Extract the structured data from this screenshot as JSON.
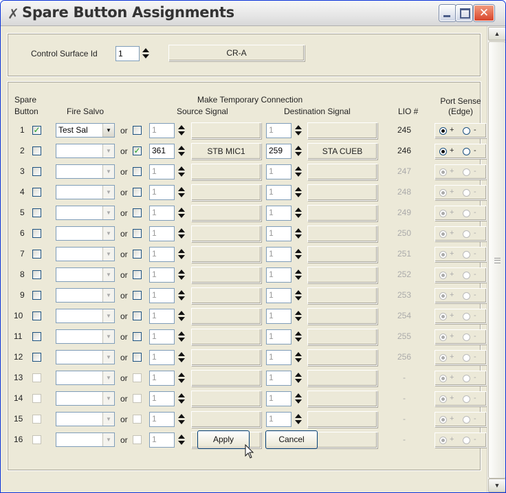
{
  "window": {
    "title": "Spare Button Assignments",
    "app_icon": "✗",
    "controls": {
      "minimize": "minimize",
      "maximize": "maximize",
      "close": "✕"
    }
  },
  "control_surface": {
    "label": "Control Surface Id",
    "id_value": "1",
    "name": "CR-A"
  },
  "headers": {
    "spare_button": [
      "Spare",
      "Button"
    ],
    "fire_salvo": "Fire Salvo",
    "make_temp": "Make Temporary Connection",
    "source": "Source Signal",
    "destination": "Destination Signal",
    "lio": "LIO #",
    "port_sense": [
      "Port Sense",
      "(Edge)"
    ],
    "or_label": "or"
  },
  "rows": [
    {
      "num": "1",
      "salvo_checked": true,
      "salvo": "Test Sal",
      "conn_checked": false,
      "src": "1",
      "src_name": "",
      "dst": "1",
      "dst_name": "",
      "lio": "245",
      "lio_enabled": true,
      "sense_enabled": true
    },
    {
      "num": "2",
      "salvo_checked": false,
      "salvo": "",
      "conn_checked": true,
      "src": "361",
      "src_name": "STB MIC1",
      "dst": "259",
      "dst_name": "STA CUEB",
      "lio": "246",
      "lio_enabled": true,
      "sense_enabled": true
    },
    {
      "num": "3",
      "salvo_checked": false,
      "salvo": "",
      "conn_checked": false,
      "src": "1",
      "src_name": "",
      "dst": "1",
      "dst_name": "",
      "lio": "247",
      "lio_enabled": false,
      "sense_enabled": false
    },
    {
      "num": "4",
      "salvo_checked": false,
      "salvo": "",
      "conn_checked": false,
      "src": "1",
      "src_name": "",
      "dst": "1",
      "dst_name": "",
      "lio": "248",
      "lio_enabled": false,
      "sense_enabled": false
    },
    {
      "num": "5",
      "salvo_checked": false,
      "salvo": "",
      "conn_checked": false,
      "src": "1",
      "src_name": "",
      "dst": "1",
      "dst_name": "",
      "lio": "249",
      "lio_enabled": false,
      "sense_enabled": false
    },
    {
      "num": "6",
      "salvo_checked": false,
      "salvo": "",
      "conn_checked": false,
      "src": "1",
      "src_name": "",
      "dst": "1",
      "dst_name": "",
      "lio": "250",
      "lio_enabled": false,
      "sense_enabled": false
    },
    {
      "num": "7",
      "salvo_checked": false,
      "salvo": "",
      "conn_checked": false,
      "src": "1",
      "src_name": "",
      "dst": "1",
      "dst_name": "",
      "lio": "251",
      "lio_enabled": false,
      "sense_enabled": false
    },
    {
      "num": "8",
      "salvo_checked": false,
      "salvo": "",
      "conn_checked": false,
      "src": "1",
      "src_name": "",
      "dst": "1",
      "dst_name": "",
      "lio": "252",
      "lio_enabled": false,
      "sense_enabled": false
    },
    {
      "num": "9",
      "salvo_checked": false,
      "salvo": "",
      "conn_checked": false,
      "src": "1",
      "src_name": "",
      "dst": "1",
      "dst_name": "",
      "lio": "253",
      "lio_enabled": false,
      "sense_enabled": false
    },
    {
      "num": "10",
      "salvo_checked": false,
      "salvo": "",
      "conn_checked": false,
      "src": "1",
      "src_name": "",
      "dst": "1",
      "dst_name": "",
      "lio": "254",
      "lio_enabled": false,
      "sense_enabled": false
    },
    {
      "num": "11",
      "salvo_checked": false,
      "salvo": "",
      "conn_checked": false,
      "src": "1",
      "src_name": "",
      "dst": "1",
      "dst_name": "",
      "lio": "255",
      "lio_enabled": false,
      "sense_enabled": false
    },
    {
      "num": "12",
      "salvo_checked": false,
      "salvo": "",
      "conn_checked": false,
      "src": "1",
      "src_name": "",
      "dst": "1",
      "dst_name": "",
      "lio": "256",
      "lio_enabled": false,
      "sense_enabled": false
    },
    {
      "num": "13",
      "salvo_checked": false,
      "salvo": "",
      "conn_checked": false,
      "src": "1",
      "src_name": "",
      "dst": "1",
      "dst_name": "",
      "lio": "-",
      "lio_enabled": false,
      "sense_enabled": false
    },
    {
      "num": "14",
      "salvo_checked": false,
      "salvo": "",
      "conn_checked": false,
      "src": "1",
      "src_name": "",
      "dst": "1",
      "dst_name": "",
      "lio": "-",
      "lio_enabled": false,
      "sense_enabled": false
    },
    {
      "num": "15",
      "salvo_checked": false,
      "salvo": "",
      "conn_checked": false,
      "src": "1",
      "src_name": "",
      "dst": "1",
      "dst_name": "",
      "lio": "-",
      "lio_enabled": false,
      "sense_enabled": false
    },
    {
      "num": "16",
      "salvo_checked": false,
      "salvo": "",
      "conn_checked": false,
      "src": "1",
      "src_name": "",
      "dst": "1",
      "dst_name": "",
      "lio": "-",
      "lio_enabled": false,
      "sense_enabled": false
    }
  ],
  "sense": {
    "plus": "+",
    "minus": "-"
  },
  "buttons": {
    "apply": "Apply",
    "cancel": "Cancel"
  }
}
